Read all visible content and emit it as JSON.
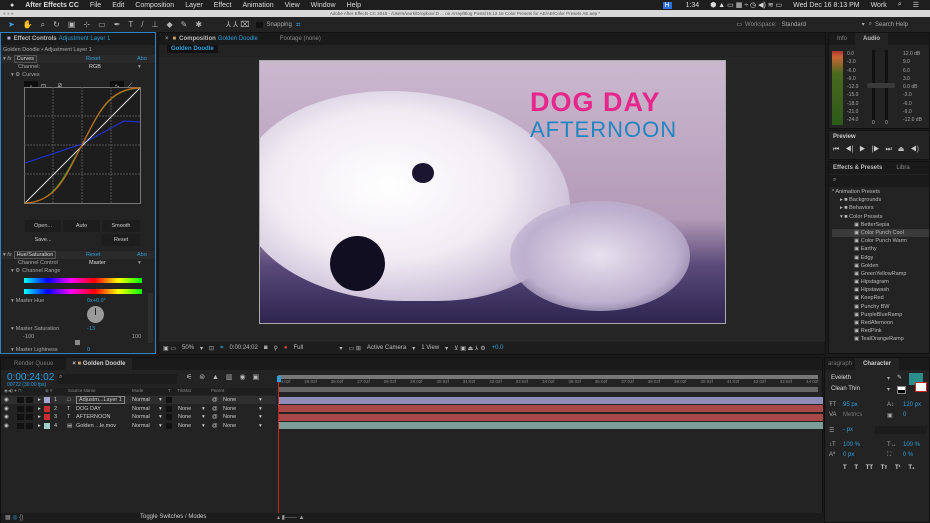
{
  "menubar": {
    "apple": "",
    "app": "After Effects CC",
    "items": [
      "File",
      "Edit",
      "Composition",
      "Layer",
      "Effect",
      "Animation",
      "View",
      "Window",
      "Help"
    ],
    "status": {
      "badge": "H",
      "time_left": "1:34",
      "clock": "Wed Dec 16  8:13 PM",
      "user": "Work"
    }
  },
  "window_title": "Adobe After Effects CC 2015 - /Users/work/Dropbox/.D ... on Array/Blog Posts/15.12.16 Color Presets for AE/AE/Color Presets AE.aep *",
  "toolbar": {
    "snapping": "Snapping",
    "workspace_label": "Workspace:",
    "workspace_value": "Standard",
    "search": "Search Help"
  },
  "effect_controls": {
    "tab_prefix": "Effect Controls",
    "tab_layer": "Adjustment Layer 1",
    "breadcrumb": "Golden Doodle • Adjustment Layer 1",
    "curves": {
      "name": "Curves",
      "reset": "Reset",
      "about": "Abo",
      "channel_label": "Channel:",
      "channel_value": "RGB",
      "sub": "Curves",
      "open": "Open...",
      "auto": "Auto",
      "smooth": "Smooth",
      "save": "Save...",
      "reset_btn": "Reset"
    },
    "hue_sat": {
      "name": "Hue/Saturation",
      "reset": "Reset",
      "about": "Abo",
      "channel_control_label": "Channel Control",
      "channel_control_value": "Master",
      "channel_range": "Channel Range",
      "master_hue_label": "Master Hue",
      "master_hue_value": "0x+0.0°",
      "master_sat_label": "Master Saturation",
      "master_sat_value": "-13",
      "sat_min": "-100",
      "sat_max": "100",
      "master_light_label": "Master Lightness",
      "master_light_value": "0",
      "saturation_fraction": 0.435
    }
  },
  "composition": {
    "tab_prefix": "Composition",
    "tab_name": "Golden Doodle",
    "footage_tab": "Footage (none)",
    "subtab": "Golden Doodle",
    "title_line1": "DOG DAY",
    "title_line2": "AFTERNOON",
    "colors": {
      "title1": "#e8258a",
      "title2": "#1f86c0"
    },
    "viewer_bar": {
      "zoom": "50%",
      "timecode": "0:00:24:02",
      "resolution": "Full",
      "camera": "Active Camera",
      "views": "1 View",
      "exposure": "+0.0"
    }
  },
  "info_tab": "Info",
  "audio": {
    "tab": "Audio",
    "left_scale": [
      "0.0",
      "-3.0",
      "-6.0",
      "-9.0",
      "-12.0",
      "-15.0",
      "-18.0",
      "-21.0",
      "-24.0"
    ],
    "right_scale": [
      "12.0 dB",
      "9.0",
      "6.0",
      "3.0",
      "0.0 dB",
      "-3.0",
      "-6.0",
      "-9.0",
      "-12.0 dB"
    ],
    "slider_left": "0",
    "slider_right": "0"
  },
  "preview": {
    "title": "Preview"
  },
  "effects_presets": {
    "tab": "Effects & Presets",
    "tab2": "Libra",
    "search_placeholder": "",
    "root": "* Animation Presets",
    "folders": [
      "Backgrounds",
      "Behaviors",
      "Color Presets"
    ],
    "presets": [
      "BetterSepia",
      "Color Punch Cool",
      "Color Punch Warm",
      "Earthy",
      "Edgy",
      "Golden",
      "GreenYellowRamp",
      "Hipstagram",
      "Hipstawash",
      "KeepRed",
      "Punchy BW",
      "PurpleBlueRamp",
      "RedAfernoon",
      "RedPink",
      "TealOrangeRamp"
    ],
    "selected": "Color Punch Cool"
  },
  "timeline": {
    "tab_render": "Render Queue",
    "tab_comp": "Golden Doodle",
    "timecode": "0:00:24:02",
    "frame_info": "00722 (30.00 fps)",
    "columns": {
      "source": "Source Name",
      "mode": "Mode",
      "t": "T",
      "trkmat": "TrkMat",
      "parent": "Parent"
    },
    "layers": [
      {
        "num": "1",
        "name": "Adjustm...Layer 1",
        "mode": "Normal",
        "trkmat": "",
        "parent": "None",
        "color": "#a9a6d6",
        "bar": "#8f8cba"
      },
      {
        "num": "2",
        "name": "DOG DAY",
        "mode": "Normal",
        "trkmat": "None",
        "parent": "None",
        "color": "#c53030",
        "bar": "#a84848"
      },
      {
        "num": "3",
        "name": "AFTERNOON",
        "mode": "Normal",
        "trkmat": "None",
        "parent": "None",
        "color": "#c53030",
        "bar": "#a84848"
      },
      {
        "num": "4",
        "name": "Golden ...le.mov",
        "mode": "Normal",
        "trkmat": "None",
        "parent": "None",
        "color": "#9dd1c8",
        "bar": "#7d9e98"
      }
    ],
    "ruler": [
      "24:02f",
      "25:02f",
      "26:02f",
      "27:02f",
      "28:02f",
      "29:02f",
      "30:02f",
      "31:02f",
      "32:02f",
      "33:02f",
      "34:02f",
      "35:02f",
      "36:02f",
      "37:02f",
      "38:02f",
      "39:02f",
      "40:02f",
      "41:02f",
      "42:02f",
      "43:02f",
      "44:02f"
    ],
    "toggle": "Toggle Switches / Modes"
  },
  "character": {
    "tab_para": "aragraph",
    "tab": "Character",
    "font": "Eveleth",
    "style": "Clean Thin",
    "size": "95 px",
    "leading": "120 px",
    "kerning": "Metrics",
    "tracking": "0",
    "stroke": "- px",
    "vscale": "100 %",
    "hscale": "100 %",
    "baseline": "0 px",
    "tsume": "0 %",
    "fill_color": "#2a8f8c",
    "styles": [
      "T",
      "T",
      "TT",
      "Tт",
      "T¹",
      "T₁"
    ]
  }
}
